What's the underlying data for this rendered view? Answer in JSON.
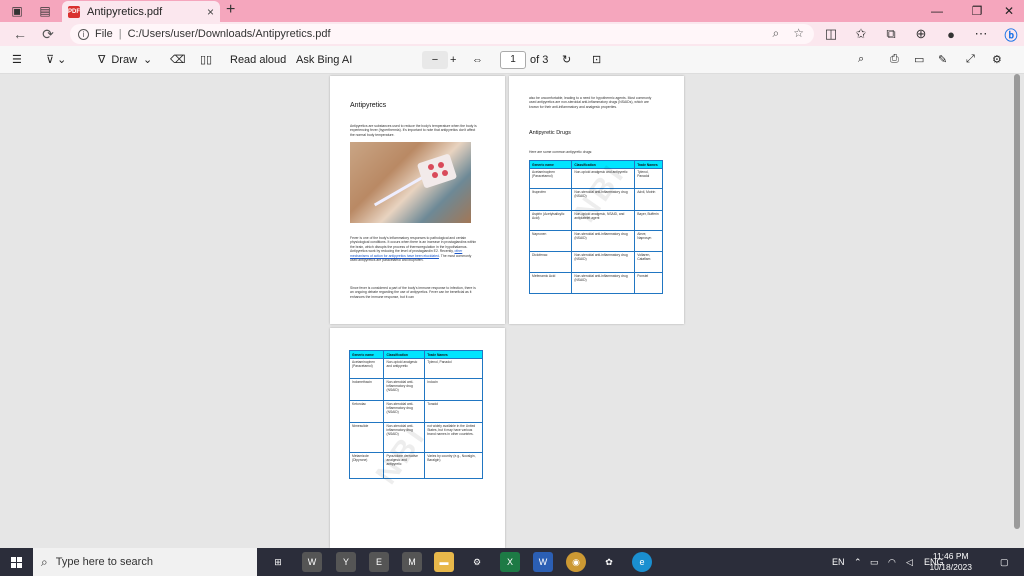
{
  "browser": {
    "tab_title": "Antipyretics.pdf",
    "tab_close": "×",
    "new_tab": "+",
    "address_scheme": "File",
    "address_path": "C:/Users/user/Downloads/Antipyretics.pdf"
  },
  "pdf_toolbar": {
    "draw_label": "Draw",
    "read_aloud_label": "Read aloud",
    "ask_bing_label": "Ask Bing AI",
    "zoom_out": "−",
    "zoom_in": "+",
    "current_page": "1",
    "page_total": "of 3"
  },
  "page1": {
    "title": "Antipyretics",
    "intro": "Antipyretics are substances used to reduce the body's temperature when the body is experiencing fever (hyperthermia). It's important to note that antipyretics don't affect the normal body temperature.",
    "para2_before": "Fever is one of the body's inflammatory responses to pathological and certain physiological conditions. It occurs when there is an increase in prostaglandins within the brain, which disrupts the process of thermoregulation in the hypothalamus. Antipyretics work by reducing the level of prostaglandin E2. Recently, ",
    "para2_link": "other mechanisms of action for antipyretics have been elucidated",
    "para2_after": ". The most commonly used antipyretics are paracetamol and ibuprofen.",
    "para3": "Since fever is considered a part of the body's immune response to infection, there is an ongoing debate regarding the use of antipyretics. Fever can be beneficial as it enhances the immune response, but it can"
  },
  "page2": {
    "cont": "also be uncomfortable, leading to a need for hypothermic agents. Most commonly used antipyretics are non-steroidal anti-inflammatory drugs (NSAIDs), which are known for their anti-inflammatory and analgesic properties.",
    "heading": "Antipyretic Drugs",
    "subtext": "Here are some common antipyretic drugs:"
  },
  "table": {
    "headers": [
      "Generic name",
      "Classification",
      "Trade Names"
    ],
    "rows_p2": [
      [
        "Acetaminophen (Paracetamol)",
        "Non-opioid analgesic and antipyretic",
        "Tylenol, Panadol"
      ],
      [
        "Ibuprofen",
        "Non-steroidal anti-inflammatory drug (NSAID)",
        "Advil, Motrin"
      ],
      [
        "Aspirin (Acetylsalicylic Acid)",
        "Non-opioid analgesic, NSAID, and antiplatelet agent",
        "Bayer, Bufferin"
      ],
      [
        "Naproxen",
        "Non-steroidal anti-inflammatory drug (NSAID)",
        "Aleve, Naprosyn"
      ],
      [
        "Diclofenac",
        "Non-steroidal anti-inflammatory drug (NSAID)",
        "Voltaren, Cataflam"
      ],
      [
        "Mefenamic Acid",
        "Non-steroidal anti-inflammatory drug (NSAID)",
        "Ponstel"
      ]
    ],
    "rows_p3": [
      [
        "Acetaminophen (Paracetamol)",
        "Non-opioid analgesic and antipyretic",
        "Tylenol, Panadol"
      ],
      [
        "Indomethacin",
        "Non-steroidal anti-inflammatory drug (NSAID)",
        "Indocin"
      ],
      [
        "Ketorolac",
        "Non-steroidal anti-inflammatory drug (NSAID)",
        "Toradol"
      ],
      [
        "Nimesulide",
        "Non-steroidal anti-inflammatory drug (NSAID)",
        "not widely available in the United States, but it may have various brand names in other countries."
      ],
      [
        "Metamizole (Dipyrone)",
        "Pyrazolone derivative analgesic and antipyretic",
        "Varies by country (e.g., Novalgin, Baralgin)"
      ]
    ]
  },
  "watermark": "NBI",
  "taskbar": {
    "search_placeholder": "Type here to search",
    "lang1": "EN",
    "lang2": "ENG",
    "time": "11:46 PM",
    "date": "10/18/2023"
  },
  "colors": {
    "tab_bar": "#f5a6bd",
    "table_header": "#00e5ff",
    "table_border": "#2176c2",
    "taskbar": "#2b2d3a"
  }
}
